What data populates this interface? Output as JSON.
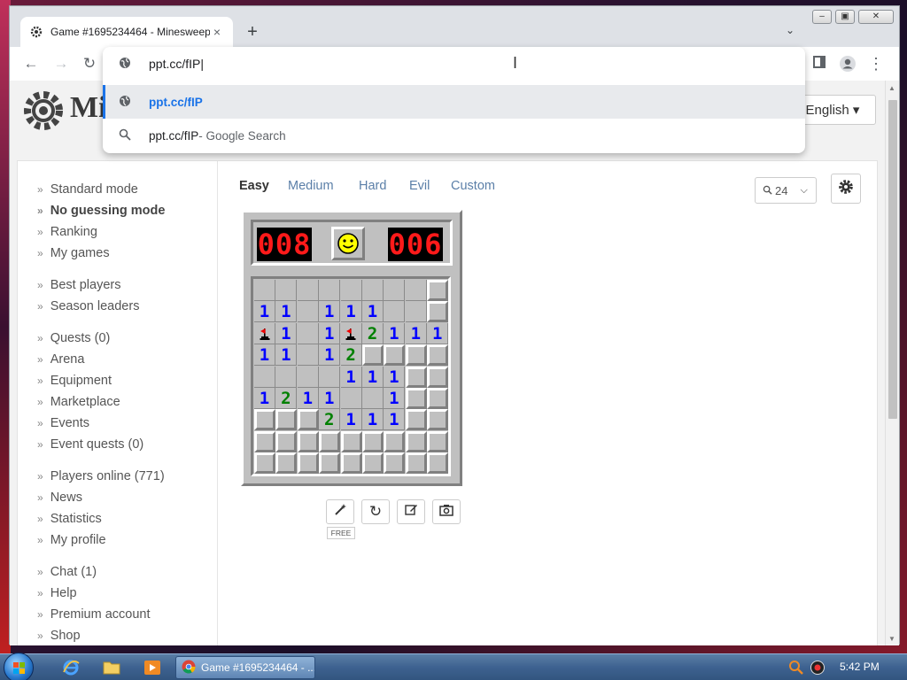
{
  "browser": {
    "tab_title": "Game #1695234464 - Minesweeper",
    "tab_close": "×",
    "new_tab": "+",
    "address_value": "ppt.cc/fIP",
    "suggestions": [
      {
        "main": "ppt.cc/fIP",
        "sub": ""
      },
      {
        "main": "ppt.cc/fIP",
        "sub": " - Google Search"
      }
    ]
  },
  "site": {
    "logo_text": "Mi",
    "language_label": "English ▾"
  },
  "sidebar": {
    "groups": [
      [
        "Standard mode",
        "No guessing mode",
        "Ranking",
        "My games"
      ],
      [
        "Best players",
        "Season leaders"
      ],
      [
        "Quests (0)",
        "Arena",
        "Equipment",
        "Marketplace",
        "Events",
        "Event quests (0)"
      ],
      [
        "Players online (771)",
        "News",
        "Statistics",
        "My profile"
      ],
      [
        "Chat (1)",
        "Help",
        "Premium account",
        "Shop"
      ]
    ]
  },
  "modes": [
    "Easy",
    "Medium",
    "Hard",
    "Evil",
    "Custom"
  ],
  "active_mode": "Easy",
  "zoom": {
    "value": "24"
  },
  "game": {
    "mines_left": "008",
    "timer": "006",
    "board": [
      "________",
      "11_111__",
      "F1_1F2111",
      "11_12...",
      "____111.",
      "1211__1.",
      "...2111.",
      "........",
      "........"
    ]
  },
  "tools": {
    "free_label": "FREE"
  },
  "taskbar": {
    "app_label": "Game #1695234464 - ...",
    "clock": "5:42 PM"
  }
}
